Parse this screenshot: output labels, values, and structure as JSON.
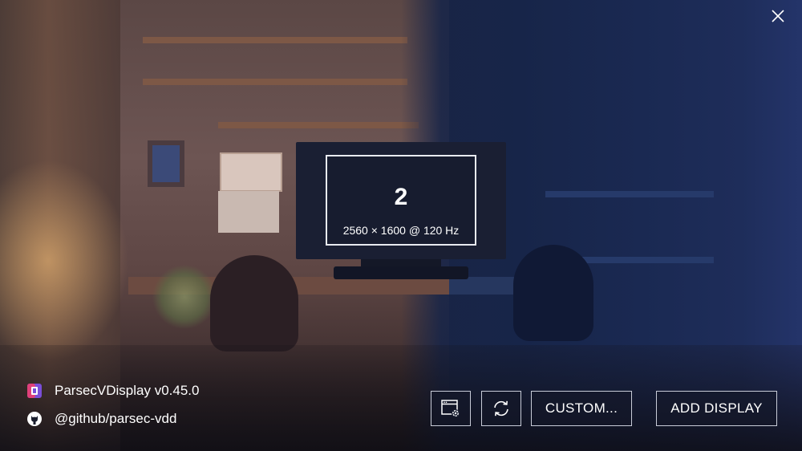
{
  "window": {
    "close_icon": "close-icon"
  },
  "display": {
    "number": "2",
    "mode": "2560 × 1600 @ 120 Hz"
  },
  "app_info": {
    "name_version": "ParsecVDisplay v0.45.0",
    "github_handle": "@github/parsec-vdd",
    "app_icon": "parsec-logo-icon",
    "github_icon": "github-icon"
  },
  "toolbar": {
    "settings_icon": "display-settings-icon",
    "refresh_icon": "refresh-icon",
    "custom_label": "CUSTOM...",
    "add_display_label": "ADD DISPLAY"
  },
  "colors": {
    "accent": "#ffffff",
    "button_border": "#c8ccd8",
    "logo_pink": "#e0407a",
    "logo_purple": "#7a4ed8"
  }
}
